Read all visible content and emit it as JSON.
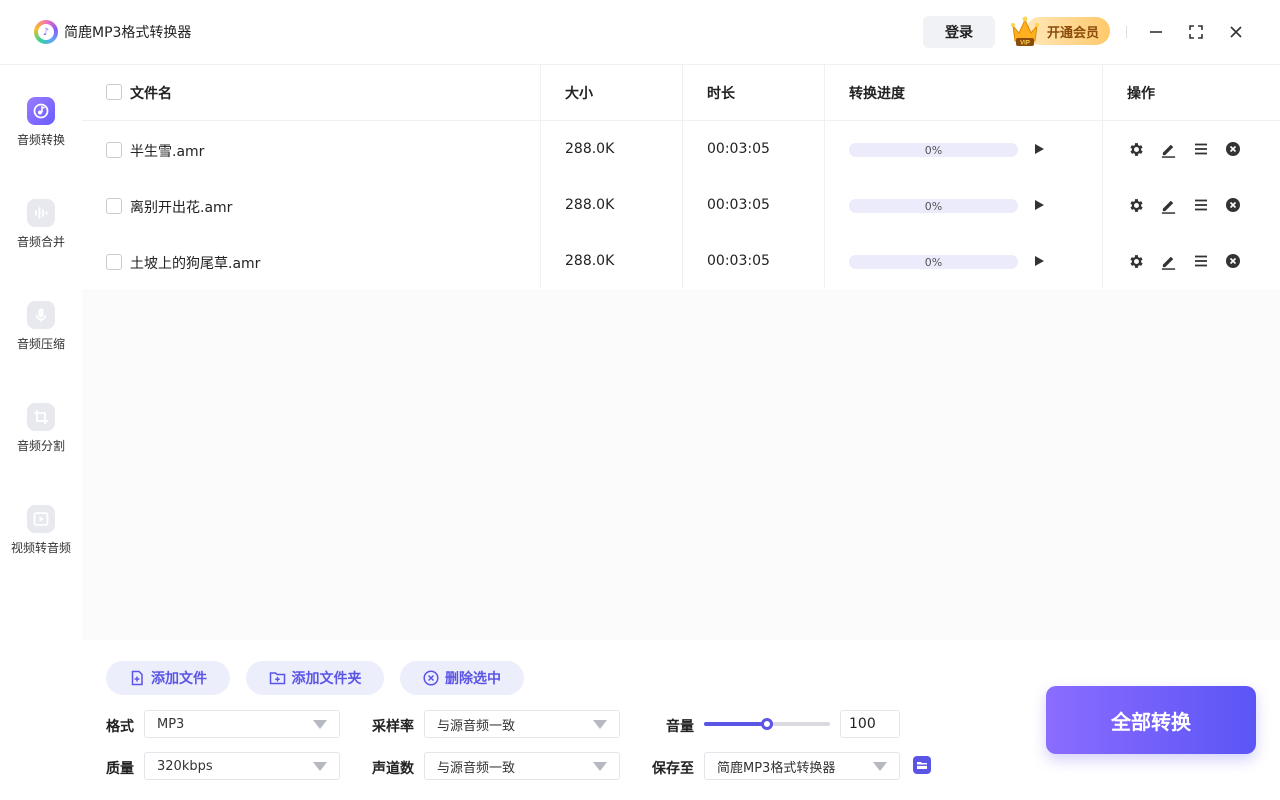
{
  "app": {
    "title": "简鹿MP3格式转换器"
  },
  "header": {
    "login_label": "登录",
    "vip_label": "开通会员",
    "vip_badge": "VIP"
  },
  "sidebar": {
    "items": [
      {
        "label": "音频转换",
        "icon": "audio-convert-icon",
        "active": true
      },
      {
        "label": "音频合并",
        "icon": "audio-merge-icon",
        "active": false
      },
      {
        "label": "音频压缩",
        "icon": "microphone-icon",
        "active": false
      },
      {
        "label": "音频分割",
        "icon": "crop-icon",
        "active": false
      },
      {
        "label": "视频转音频",
        "icon": "video-play-icon",
        "active": false
      }
    ]
  },
  "table": {
    "columns": {
      "name": "文件名",
      "size": "大小",
      "duration": "时长",
      "progress": "转换进度",
      "ops": "操作"
    },
    "rows": [
      {
        "name": "半生雪.amr",
        "size": "288.0K",
        "duration": "00:03:05",
        "progress": "0%"
      },
      {
        "name": "离别开出花.amr",
        "size": "288.0K",
        "duration": "00:03:05",
        "progress": "0%"
      },
      {
        "name": "土坡上的狗尾草.amr",
        "size": "288.0K",
        "duration": "00:03:05",
        "progress": "0%"
      }
    ]
  },
  "bottom": {
    "add_file": "添加文件",
    "add_folder": "添加文件夹",
    "delete_selected": "删除选中",
    "format_label": "格式",
    "format_value": "MP3",
    "quality_label": "质量",
    "quality_value": "320kbps",
    "samplerate_label": "采样率",
    "samplerate_value": "与源音频一致",
    "channels_label": "声道数",
    "channels_value": "与源音频一致",
    "volume_label": "音量",
    "volume_value": "100",
    "volume_level": 0.5,
    "saveto_label": "保存至",
    "saveto_value": "简鹿MP3格式转换器",
    "convert_all": "全部转换"
  },
  "colors": {
    "accent": "#5b55e6",
    "accent_light": "#edeefc",
    "vip_gold": "#ffc96b"
  }
}
